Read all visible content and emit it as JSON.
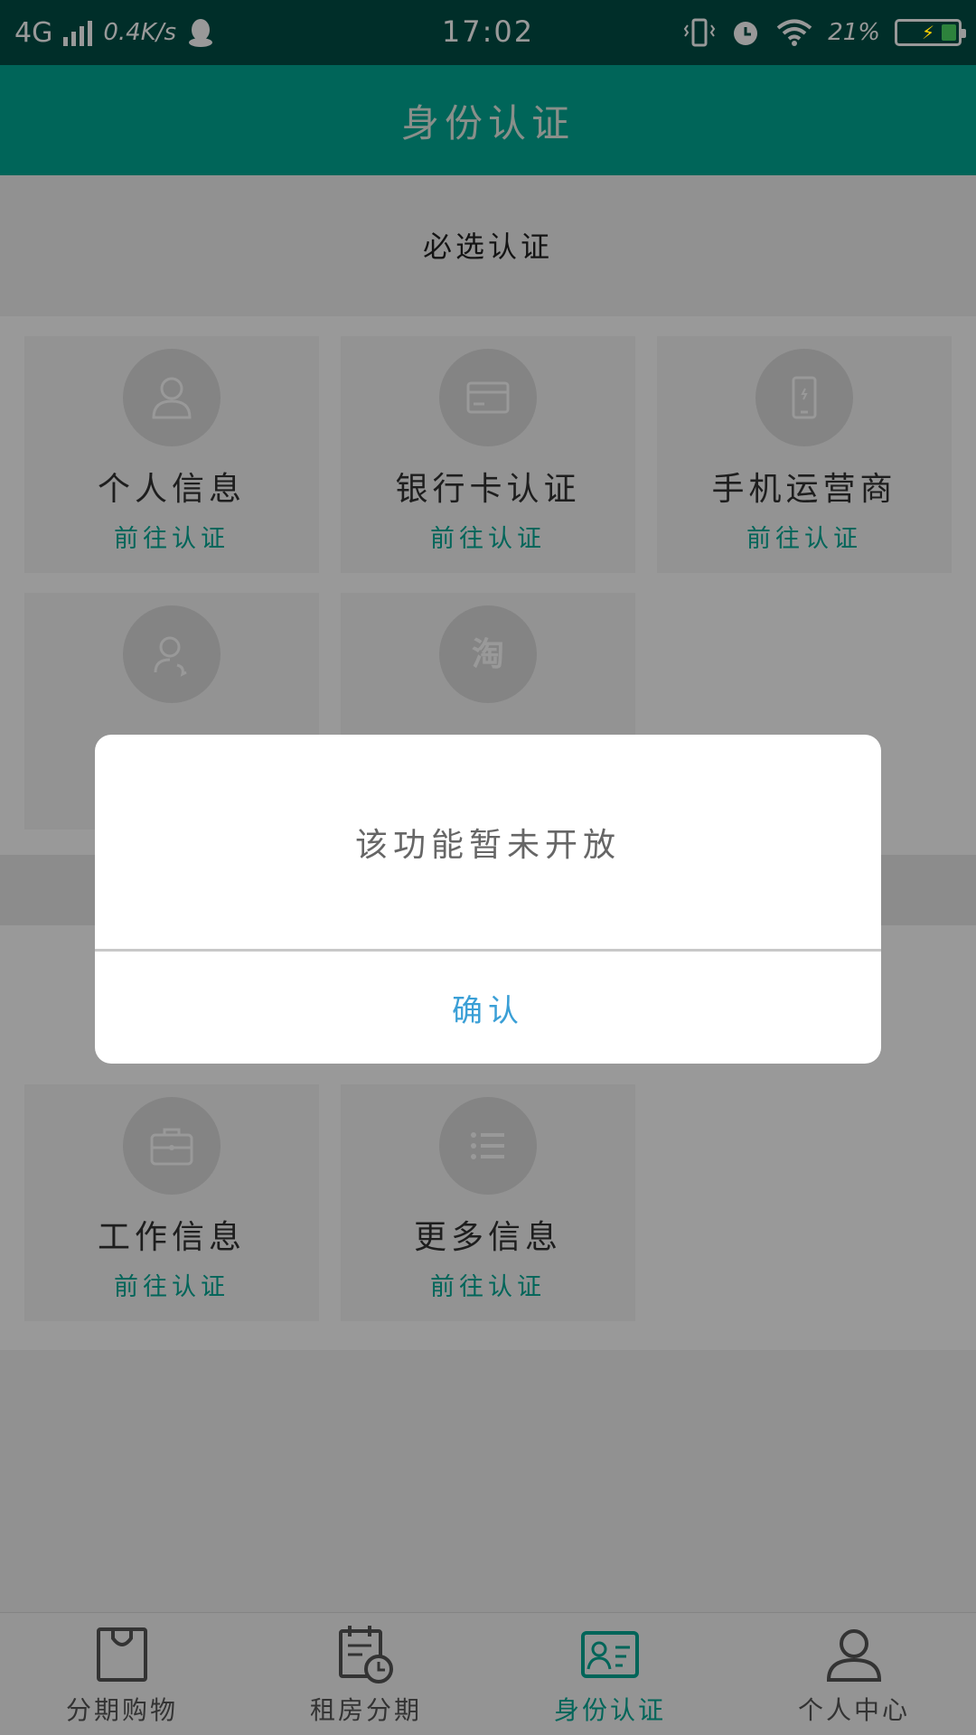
{
  "status_bar": {
    "network": "4G",
    "speed": "0.4K/s",
    "time": "17:02",
    "battery": "21%"
  },
  "header": {
    "title": "身份认证"
  },
  "required_section": {
    "title": "必选认证",
    "cards": [
      {
        "label": "个人信息",
        "action": "前往认证",
        "icon": "person-icon"
      },
      {
        "label": "银行卡认证",
        "action": "前往认证",
        "icon": "bank-card-icon"
      },
      {
        "label": "手机运营商",
        "action": "前往认证",
        "icon": "phone-icon"
      },
      {
        "label": "",
        "action": "",
        "icon": "contact-icon"
      },
      {
        "label": "",
        "action": "",
        "icon": "taobao-icon"
      }
    ]
  },
  "optional_section": {
    "cards": [
      {
        "label": "工作信息",
        "action": "前往认证",
        "icon": "briefcase-icon"
      },
      {
        "label": "更多信息",
        "action": "前往认证",
        "icon": "list-icon"
      }
    ]
  },
  "dialog": {
    "message": "该功能暂未开放",
    "confirm_label": "确认"
  },
  "bottom_nav": {
    "items": [
      {
        "label": "分期购物",
        "icon": "shopping-bag-icon"
      },
      {
        "label": "租房分期",
        "icon": "calendar-clock-icon"
      },
      {
        "label": "身份认证",
        "icon": "id-card-icon",
        "active": true
      },
      {
        "label": "个人中心",
        "icon": "user-icon"
      }
    ]
  },
  "colors": {
    "brand": "#00a895",
    "status_bar": "#004d45",
    "dialog_button": "#3a9fd6"
  }
}
